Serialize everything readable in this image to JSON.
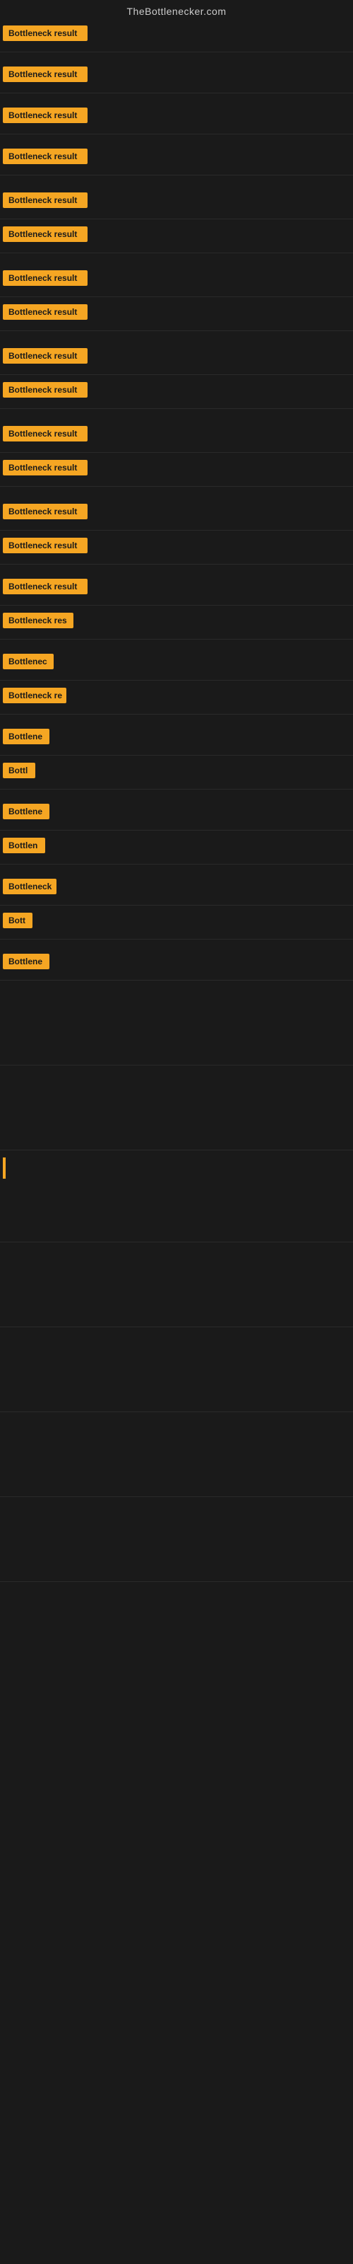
{
  "site": {
    "title": "TheBottlenecker.com"
  },
  "items": [
    {
      "id": 1,
      "label": "Bottleneck result",
      "width": 120,
      "topSpacing": 8
    },
    {
      "id": 2,
      "label": "Bottleneck result",
      "width": 120,
      "topSpacing": 20
    },
    {
      "id": 3,
      "label": "Bottleneck result",
      "width": 120,
      "topSpacing": 20
    },
    {
      "id": 4,
      "label": "Bottleneck result",
      "width": 120,
      "topSpacing": 20
    },
    {
      "id": 5,
      "label": "Bottleneck result",
      "width": 120,
      "topSpacing": 24
    },
    {
      "id": 6,
      "label": "Bottleneck result",
      "width": 120,
      "topSpacing": 10
    },
    {
      "id": 7,
      "label": "Bottleneck result",
      "width": 120,
      "topSpacing": 24
    },
    {
      "id": 8,
      "label": "Bottleneck result",
      "width": 120,
      "topSpacing": 10
    },
    {
      "id": 9,
      "label": "Bottleneck result",
      "width": 120,
      "topSpacing": 24
    },
    {
      "id": 10,
      "label": "Bottleneck result",
      "width": 120,
      "topSpacing": 10
    },
    {
      "id": 11,
      "label": "Bottleneck result",
      "width": 120,
      "topSpacing": 24
    },
    {
      "id": 12,
      "label": "Bottleneck result",
      "width": 120,
      "topSpacing": 10
    },
    {
      "id": 13,
      "label": "Bottleneck result",
      "width": 120,
      "topSpacing": 24
    },
    {
      "id": 14,
      "label": "Bottleneck result",
      "width": 120,
      "topSpacing": 10
    },
    {
      "id": 15,
      "label": "Bottleneck result",
      "width": 120,
      "topSpacing": 20
    },
    {
      "id": 16,
      "label": "Bottleneck res",
      "width": 100,
      "topSpacing": 10
    },
    {
      "id": 17,
      "label": "Bottlenec",
      "width": 72,
      "topSpacing": 20
    },
    {
      "id": 18,
      "label": "Bottleneck re",
      "width": 90,
      "topSpacing": 10
    },
    {
      "id": 19,
      "label": "Bottlene",
      "width": 66,
      "topSpacing": 20
    },
    {
      "id": 20,
      "label": "Bottl",
      "width": 46,
      "topSpacing": 10
    },
    {
      "id": 21,
      "label": "Bottlene",
      "width": 66,
      "topSpacing": 20
    },
    {
      "id": 22,
      "label": "Bottlen",
      "width": 60,
      "topSpacing": 10
    },
    {
      "id": 23,
      "label": "Bottleneck",
      "width": 76,
      "topSpacing": 20
    },
    {
      "id": 24,
      "label": "Bott",
      "width": 42,
      "topSpacing": 10
    },
    {
      "id": 25,
      "label": "Bottlene",
      "width": 66,
      "topSpacing": 20
    }
  ],
  "colors": {
    "badge_bg": "#f5a623",
    "badge_text": "#1a1a1a",
    "body_bg": "#1a1a1a",
    "header_text": "#cccccc"
  }
}
